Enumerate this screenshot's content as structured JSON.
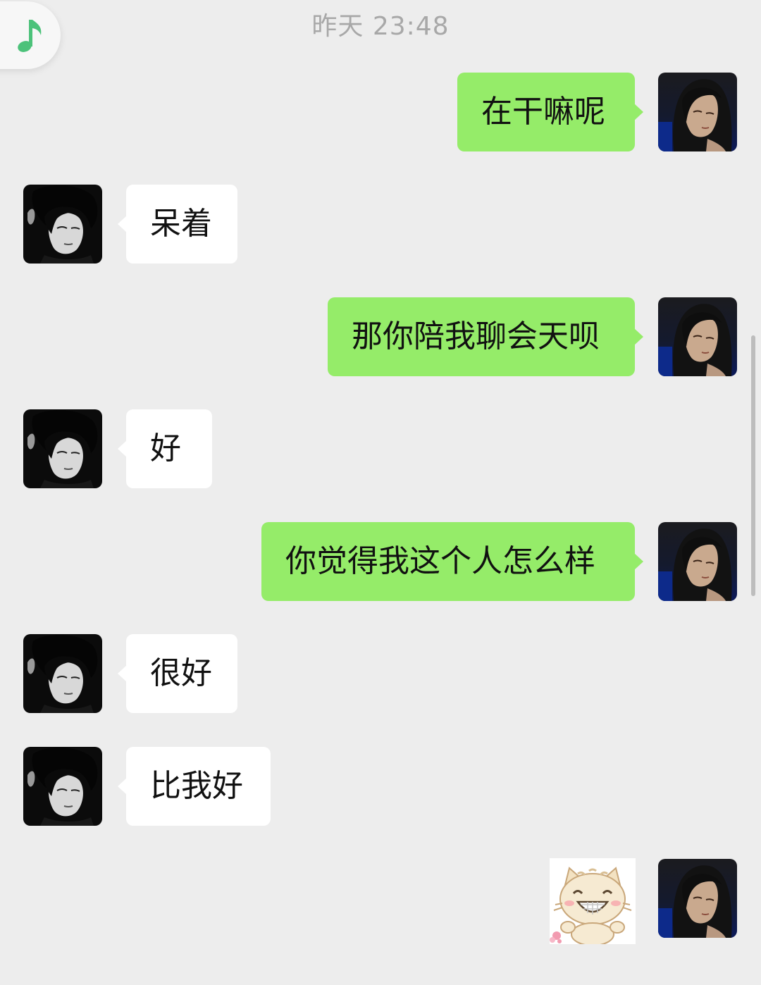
{
  "timestamp": "昨天 23:48",
  "colors": {
    "background": "#ededed",
    "my_bubble": "#95ec69",
    "their_bubble": "#ffffff",
    "music_note": "#4cc27a"
  },
  "floating_player": {
    "icon": "music-note-icon"
  },
  "messages": [
    {
      "sender": "me",
      "text": "在干嘛呢"
    },
    {
      "sender": "them",
      "text": "呆着"
    },
    {
      "sender": "me",
      "text": "那你陪我聊会天呗"
    },
    {
      "sender": "them",
      "text": "好"
    },
    {
      "sender": "me",
      "text": "你觉得我这个人怎么样"
    },
    {
      "sender": "them",
      "text": "很好"
    },
    {
      "sender": "them",
      "text": "比我好"
    },
    {
      "sender": "me",
      "type": "sticker",
      "icon": "smiling-cat-sticker"
    }
  ]
}
